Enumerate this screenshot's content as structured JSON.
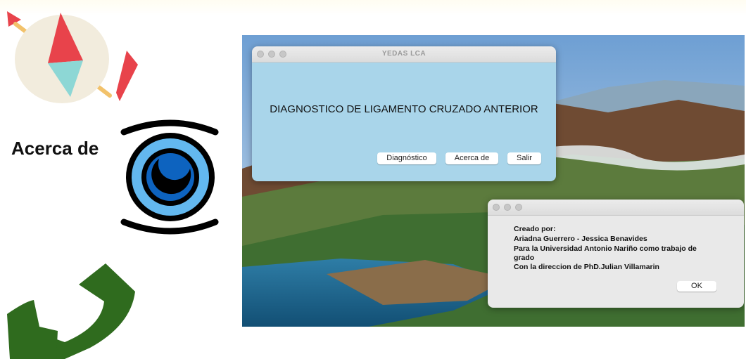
{
  "slide": {
    "heading": "Acerca de"
  },
  "main_window": {
    "title": "YEDAS LCA",
    "heading": "DIAGNOSTICO DE LIGAMENTO CRUZADO ANTERIOR",
    "buttons": {
      "diagnostico": "Diagnóstico",
      "acerca": "Acerca de",
      "salir": "Salir"
    }
  },
  "about_dialog": {
    "lines": [
      "Creado por:",
      "Ariadna Guerrero - Jessica Benavides",
      "Para la Universidad Antonio Nariño como trabajo de",
      "grado",
      "Con la direccion de PhD.Julian Villamarin"
    ],
    "ok_label": "OK"
  },
  "icons": {
    "compass": "compass-icon",
    "eye": "eye-icon",
    "arrow": "return-arrow-icon"
  },
  "colors": {
    "main_window_bg": "#a9d5ea",
    "dialog_bg": "#e9e9e9",
    "compass_red": "#e8434b",
    "compass_teal": "#8dd7d5",
    "eye_blue": "#63b8ef",
    "arrow_green": "#2f6b1e"
  }
}
